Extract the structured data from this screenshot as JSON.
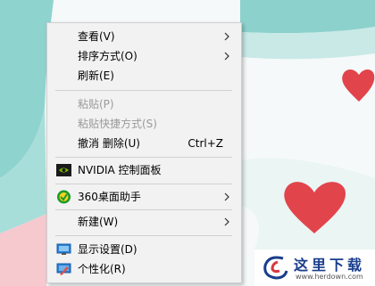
{
  "menu": {
    "view_label": "查看(V)",
    "sort_label": "排序方式(O)",
    "refresh_label": "刷新(E)",
    "paste_label": "粘贴(P)",
    "paste_shortcut_label": "粘贴快捷方式(S)",
    "undo_delete_label": "撤消 删除(U)",
    "undo_shortcut": "Ctrl+Z",
    "nvidia_label": "NVIDIA 控制面板",
    "assistant_label": "360桌面助手",
    "new_label": "新建(W)",
    "display_label": "显示设置(D)",
    "personalize_label": "个性化(R)"
  },
  "watermark": {
    "text": "这里下载",
    "url": "www.herdown.com"
  },
  "colors": {
    "teal": "#7fcfca",
    "pink": "#f3a9b3",
    "heart": "#e2444c",
    "menu_bg": "#f2f2f2",
    "disabled_text": "#9a9a9a"
  }
}
